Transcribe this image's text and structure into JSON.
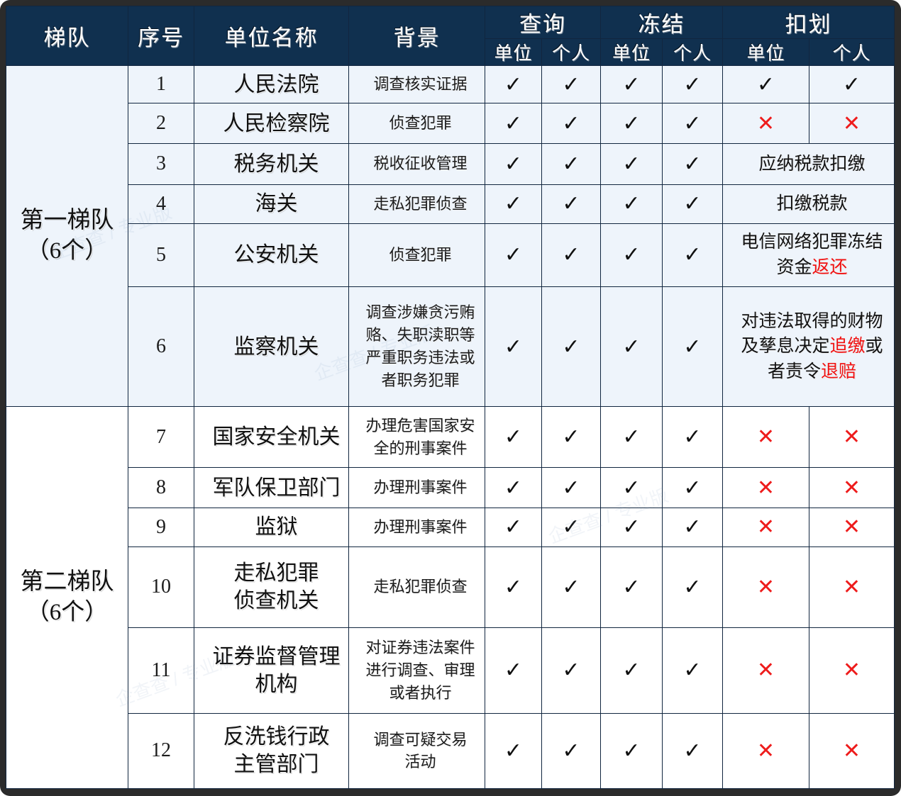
{
  "header": {
    "tier": "梯队",
    "no": "序号",
    "unit_name": "单位名称",
    "background": "背景",
    "groups": [
      {
        "label": "查询",
        "sub": [
          "单位",
          "个人"
        ]
      },
      {
        "label": "冻结",
        "sub": [
          "单位",
          "个人"
        ]
      },
      {
        "label": "扣划",
        "sub": [
          "单位",
          "个人"
        ]
      }
    ]
  },
  "colors": {
    "header_bg": "#10304f",
    "header_text": "#ffffff",
    "tier1_bg": "#eef4fb",
    "tier2_bg": "#ffffff",
    "grid_line": "#11263f",
    "frame": "#2b2b2b",
    "check": "#111111",
    "cross": "#ee1c1c",
    "highlight": "#f01010"
  },
  "icons": {
    "check": "✓",
    "cross": "✕"
  },
  "tiers": [
    {
      "label_line1": "第一梯队",
      "label_line2": "（6个）"
    },
    {
      "label_line1": "第二梯队",
      "label_line2": "（6个）"
    }
  ],
  "rows": [
    {
      "no": "1",
      "name": [
        "人民法院"
      ],
      "background": [
        "调查核实证据"
      ],
      "query_unit": "✓",
      "query_person": "✓",
      "freeze_unit": "✓",
      "freeze_person": "✓",
      "deduct_merged": false,
      "deduct_unit": "✓",
      "deduct_person": "✓"
    },
    {
      "no": "2",
      "name": [
        "人民检察院"
      ],
      "background": [
        "侦查犯罪"
      ],
      "query_unit": "✓",
      "query_person": "✓",
      "freeze_unit": "✓",
      "freeze_person": "✓",
      "deduct_merged": false,
      "deduct_unit": "✕",
      "deduct_person": "✕"
    },
    {
      "no": "3",
      "name": [
        "税务机关"
      ],
      "background": [
        "税收征收管理"
      ],
      "query_unit": "✓",
      "query_person": "✓",
      "freeze_unit": "✓",
      "freeze_person": "✓",
      "deduct_merged": true,
      "deduct_note": [
        [
          {
            "t": "应纳税款扣缴",
            "hl": false
          }
        ]
      ]
    },
    {
      "no": "4",
      "name": [
        "海关"
      ],
      "background": [
        "走私犯罪侦查"
      ],
      "query_unit": "✓",
      "query_person": "✓",
      "freeze_unit": "✓",
      "freeze_person": "✓",
      "deduct_merged": true,
      "deduct_note": [
        [
          {
            "t": "扣缴税款",
            "hl": false
          }
        ]
      ]
    },
    {
      "no": "5",
      "name": [
        "公安机关"
      ],
      "background": [
        "侦查犯罪"
      ],
      "query_unit": "✓",
      "query_person": "✓",
      "freeze_unit": "✓",
      "freeze_person": "✓",
      "deduct_merged": true,
      "deduct_note": [
        [
          {
            "t": "电信网络犯罪冻结",
            "hl": false
          }
        ],
        [
          {
            "t": "资金",
            "hl": false
          },
          {
            "t": "返还",
            "hl": true
          }
        ]
      ]
    },
    {
      "no": "6",
      "name": [
        "监察机关"
      ],
      "background": [
        "调查涉嫌贪污贿",
        "赂、失职渎职等",
        "严重职务违法或",
        "者职务犯罪"
      ],
      "query_unit": "✓",
      "query_person": "✓",
      "freeze_unit": "✓",
      "freeze_person": "✓",
      "deduct_merged": true,
      "deduct_note": [
        [
          {
            "t": "对违法取得的财物",
            "hl": false
          }
        ],
        [
          {
            "t": "及孳息决定",
            "hl": false
          },
          {
            "t": "追缴",
            "hl": true
          },
          {
            "t": "或",
            "hl": false
          }
        ],
        [
          {
            "t": "者责令",
            "hl": false
          },
          {
            "t": "退赔",
            "hl": true
          }
        ]
      ]
    },
    {
      "no": "7",
      "name": [
        "国家安全机关"
      ],
      "background": [
        "办理危害国家安",
        "全的刑事案件"
      ],
      "query_unit": "✓",
      "query_person": "✓",
      "freeze_unit": "✓",
      "freeze_person": "✓",
      "deduct_merged": false,
      "deduct_unit": "✕",
      "deduct_person": "✕"
    },
    {
      "no": "8",
      "name": [
        "军队保卫部门"
      ],
      "background": [
        "办理刑事案件"
      ],
      "query_unit": "✓",
      "query_person": "✓",
      "freeze_unit": "✓",
      "freeze_person": "✓",
      "deduct_merged": false,
      "deduct_unit": "✕",
      "deduct_person": "✕"
    },
    {
      "no": "9",
      "name": [
        "监狱"
      ],
      "background": [
        "办理刑事案件"
      ],
      "query_unit": "✓",
      "query_person": "✓",
      "freeze_unit": "✓",
      "freeze_person": "✓",
      "deduct_merged": false,
      "deduct_unit": "✕",
      "deduct_person": "✕"
    },
    {
      "no": "10",
      "name": [
        "走私犯罪",
        "侦查机关"
      ],
      "background": [
        "走私犯罪侦查"
      ],
      "query_unit": "✓",
      "query_person": "✓",
      "freeze_unit": "✓",
      "freeze_person": "✓",
      "deduct_merged": false,
      "deduct_unit": "✕",
      "deduct_person": "✕"
    },
    {
      "no": "11",
      "name": [
        "证券监督管理",
        "机构"
      ],
      "background": [
        "对证券违法案件",
        "进行调查、审理",
        "或者执行"
      ],
      "query_unit": "✓",
      "query_person": "✓",
      "freeze_unit": "✓",
      "freeze_person": "✓",
      "deduct_merged": false,
      "deduct_unit": "✕",
      "deduct_person": "✕"
    },
    {
      "no": "12",
      "name": [
        "反洗钱行政",
        "主管部门"
      ],
      "background": [
        "调查可疑交易",
        "活动"
      ],
      "query_unit": "✓",
      "query_person": "✓",
      "freeze_unit": "✓",
      "freeze_person": "✓",
      "deduct_merged": false,
      "deduct_unit": "✕",
      "deduct_person": "✕"
    }
  ]
}
